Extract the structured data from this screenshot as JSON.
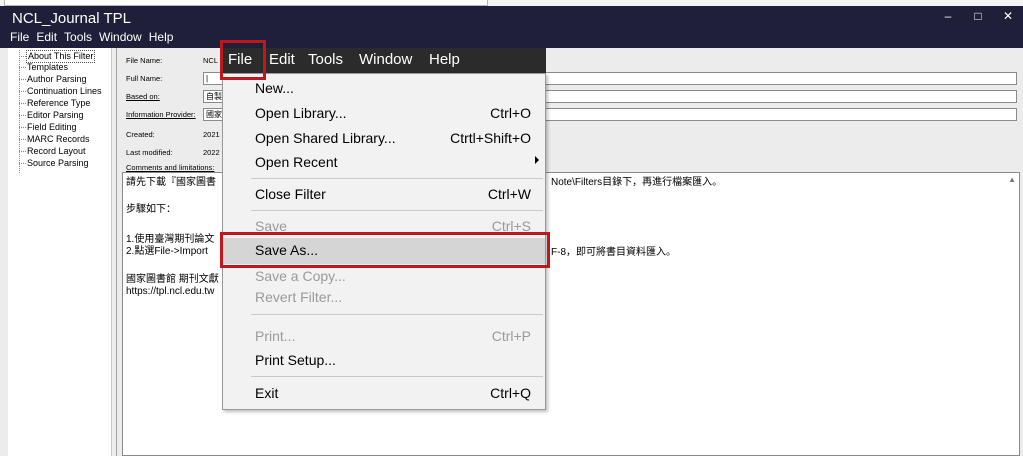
{
  "app": {
    "title": "NCL_Journal TPL",
    "menu": [
      "File",
      "Edit",
      "Tools",
      "Window",
      "Help"
    ],
    "window_controls": [
      "–",
      "□",
      "✕"
    ]
  },
  "tree": {
    "items": [
      "About This Filter",
      "Templates",
      "Author Parsing",
      "Continuation Lines",
      "Reference Type",
      "Editor Parsing",
      "Field Editing",
      "MARC Records",
      "Record Layout",
      "Source Parsing"
    ]
  },
  "fields": {
    "file_name": {
      "label": "File Name:",
      "value": "NCL"
    },
    "full_name": {
      "label": "Full Name:",
      "value": "|"
    },
    "based_on": {
      "label": "Based on:",
      "value": "自製"
    },
    "info_provider": {
      "label": "Information Provider:",
      "value": "國家"
    },
    "created": {
      "label": "Created:",
      "value": "2021"
    },
    "last_modified": {
      "label": "Last modified:",
      "value": "2022"
    },
    "comments_label": "Comments and limitations:"
  },
  "comments": {
    "line1_left": "請先下載『國家圖書",
    "line1_right": "Note\\Filters目錄下，再進行檔案匯入。",
    "line2": "步驟如下：",
    "line3": "1.使用臺灣期刊論文",
    "line4_left": "2.點選File->Import",
    "line4_right": "F-8，即可將書目資料匯入。",
    "line5": "國家圖書館 期刊文獻",
    "line6": "https://tpl.ncl.edu.tw"
  },
  "dropdown_menubar": [
    "File",
    "Edit",
    "Tools",
    "Window",
    "Help"
  ],
  "dropdown": {
    "new": {
      "label": "New...",
      "shortcut": ""
    },
    "open_library": {
      "label": "Open Library...",
      "shortcut": "Ctrl+O"
    },
    "open_shared": {
      "label": "Open Shared Library...",
      "shortcut": "Ctrtl+Shift+O"
    },
    "open_recent": {
      "label": "Open Recent",
      "shortcut": ""
    },
    "close_filter": {
      "label": "Close Filter",
      "shortcut": "Ctrl+W"
    },
    "save": {
      "label": "Save",
      "shortcut": "Ctrl+S"
    },
    "save_as": {
      "label": "Save As...",
      "shortcut": ""
    },
    "save_copy": {
      "label": "Save a Copy...",
      "shortcut": ""
    },
    "revert": {
      "label": "Revert Filter...",
      "shortcut": ""
    },
    "print": {
      "label": "Print...",
      "shortcut": "Ctrl+P"
    },
    "print_setup": {
      "label": "Print Setup...",
      "shortcut": ""
    },
    "exit": {
      "label": "Exit",
      "shortcut": "Ctrl+Q"
    }
  },
  "colors": {
    "titlebar": "#1f1f3a",
    "highlight_box": "#c0161e",
    "menu_highlight": "#d5d5d5"
  }
}
